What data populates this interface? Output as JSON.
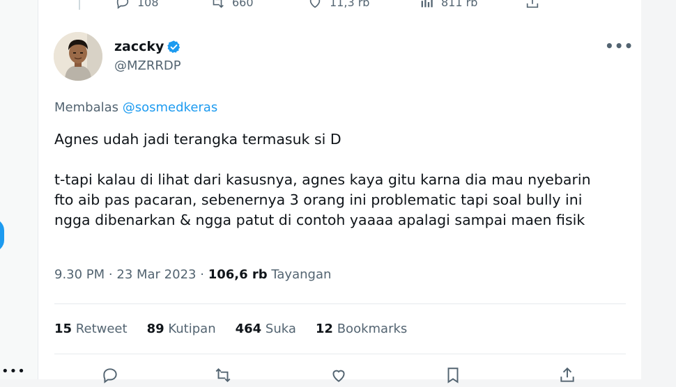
{
  "previous_tweet": {
    "replies": "108",
    "retweets": "660",
    "likes": "11,3 rb",
    "views": "811 rb"
  },
  "author": {
    "name": "zaccky",
    "handle": "@MZRRDP",
    "verified": true
  },
  "reply": {
    "prefix": "Membalas",
    "mention": "@sosmedkeras"
  },
  "tweet": {
    "line1": "Agnes udah jadi terangka termasuk si D",
    "line2": "t-tapi kalau di lihat dari kasusnya, agnes kaya gitu karna dia mau nyebarin fto aib pas pacaran, sebenernya 3 orang ini problematic tapi soal bully ini ngga dibenarkan & ngga patut di contoh yaaaa apalagi sampai maen fisik"
  },
  "meta": {
    "time": "9.30 PM",
    "date": "23 Mar 2023",
    "views_count": "106,6 rb",
    "views_label": "Tayangan"
  },
  "stats": {
    "retweets_count": "15",
    "retweets_label": "Retweet",
    "quotes_count": "89",
    "quotes_label": "Kutipan",
    "likes_count": "464",
    "likes_label": "Suka",
    "bookmarks_count": "12",
    "bookmarks_label": "Bookmarks"
  },
  "colors": {
    "accent": "#1d9bf0",
    "text": "#0f1419",
    "muted": "#536471"
  },
  "icons": {
    "more": "more-horizontal-icon",
    "verified": "verified-badge-icon",
    "reply": "reply-icon",
    "retweet": "retweet-icon",
    "like": "heart-icon",
    "bookmark": "bookmark-icon",
    "share": "share-icon",
    "views": "views-icon"
  }
}
